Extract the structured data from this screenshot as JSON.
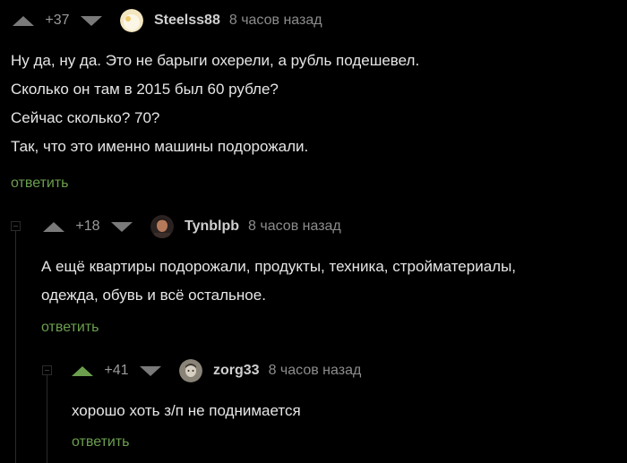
{
  "comments": [
    {
      "rating": "+37",
      "username": "Steelss88",
      "time": "8 часов назад",
      "lines": [
        "Ну да, ну да. Это не барыги охерели, а рубль подешевел.",
        "Сколько он там в 2015 был 60 рубле?",
        "Сейчас сколько? 70?",
        "Так, что это именно машины подорожали."
      ],
      "reply_label": "ответить"
    },
    {
      "rating": "+18",
      "username": "Tynblpb",
      "time": "8 часов назад",
      "lines": [
        "А ещё квартиры подорожали, продукты, техника, стройматериалы,",
        "одежда, обувь и всё остальное."
      ],
      "reply_label": "ответить"
    },
    {
      "rating": "+41",
      "username": "zorg33",
      "time": "8 часов назад",
      "lines": [
        "хорошо хоть з/п не поднимается"
      ],
      "reply_label": "ответить"
    }
  ],
  "colors": {
    "background": "#000000",
    "accent_green": "#6b9f4e",
    "text": "#e6e6e6",
    "muted": "#8c8c8c"
  }
}
